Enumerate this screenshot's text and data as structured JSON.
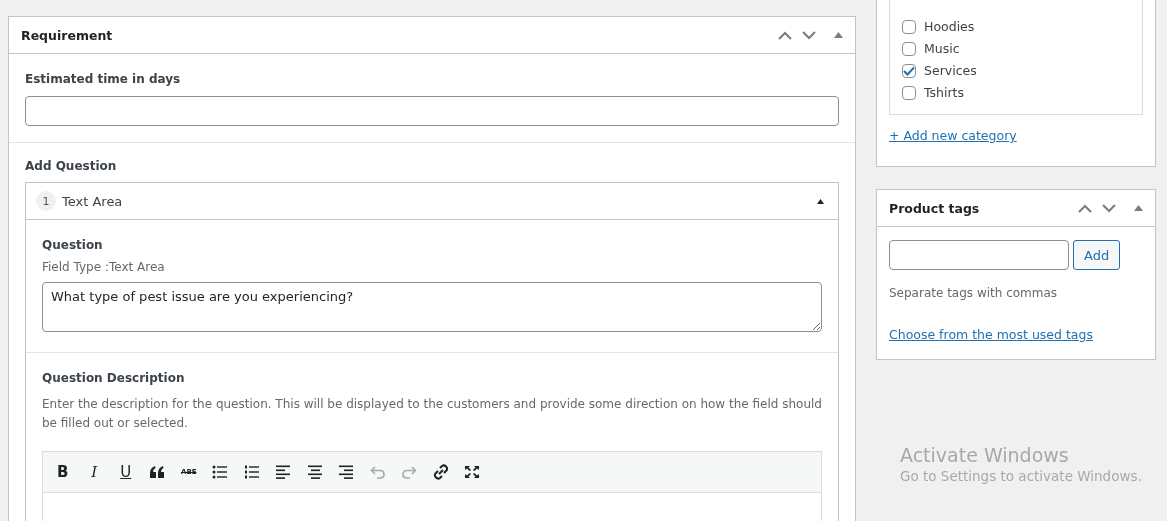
{
  "requirement": {
    "title": "Requirement",
    "estimated_label": "Estimated time in days",
    "add_question_label": "Add Question",
    "question": {
      "number": "1",
      "type": "Text Area",
      "expanded": true,
      "question_label": "Question",
      "field_type": "Field Type :Text Area",
      "question_value": "What type of pest issue are you experiencing?",
      "description_label": "Question Description",
      "description_help": "Enter the description for the question. This will be displayed to the customers and provide some direction on how the field should be filled out or selected.",
      "toolbar": [
        {
          "kind": "bold",
          "label": "B",
          "disabled": false
        },
        {
          "kind": "italic",
          "label": "I",
          "disabled": false
        },
        {
          "kind": "underline",
          "label": "U",
          "disabled": false
        },
        {
          "kind": "quote",
          "disabled": false
        },
        {
          "kind": "strike",
          "label": "ABE",
          "disabled": false
        },
        {
          "kind": "bullets",
          "disabled": false
        },
        {
          "kind": "numbers",
          "disabled": false
        },
        {
          "kind": "align-left",
          "disabled": false
        },
        {
          "kind": "align-center",
          "disabled": false
        },
        {
          "kind": "align-right",
          "disabled": false
        },
        {
          "kind": "undo",
          "disabled": true
        },
        {
          "kind": "redo",
          "disabled": true
        },
        {
          "kind": "link",
          "disabled": false
        },
        {
          "kind": "fullscreen",
          "disabled": false
        }
      ]
    }
  },
  "categories": {
    "items": [
      {
        "label": "Hoodies",
        "checked": false
      },
      {
        "label": "Music",
        "checked": false
      },
      {
        "label": "Services",
        "checked": true
      },
      {
        "label": "Tshirts",
        "checked": false
      }
    ],
    "add_link": "+ Add new category"
  },
  "product_tags": {
    "title": "Product tags",
    "add_button": "Add",
    "hint": "Separate tags with commas",
    "choose_link": "Choose from the most used tags"
  },
  "os_notice": {
    "title": "Activate Windows",
    "subtitle": "Go to Settings to activate Windows."
  }
}
